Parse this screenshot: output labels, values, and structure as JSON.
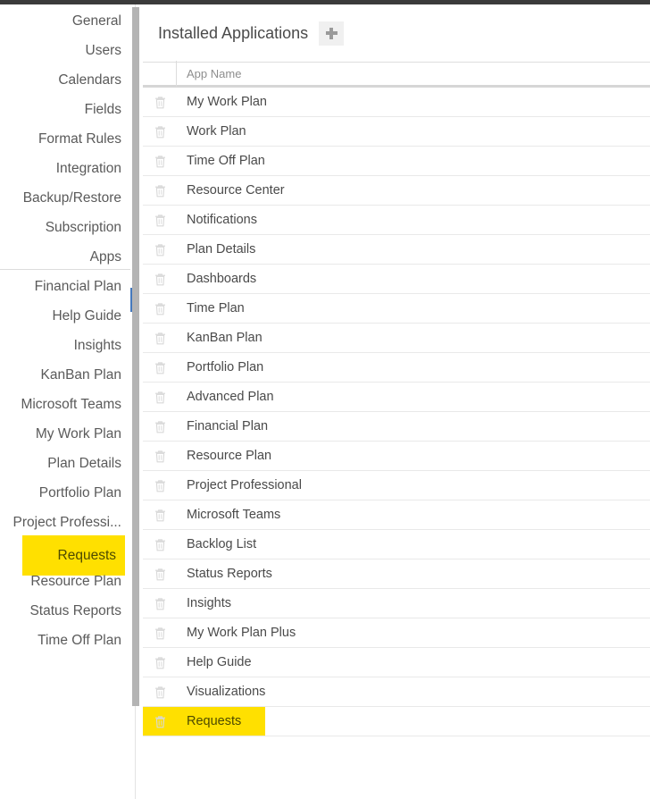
{
  "colors": {
    "accent_blue": "#4579bd",
    "highlight_yellow": "#ffe000",
    "top_strip": "#3b3b3b",
    "text_grey": "#4a4a4a",
    "sidebar_text": "#5a5a5a",
    "icon_grey": "#d8d8d8"
  },
  "sidebar": {
    "items": [
      {
        "label": "General",
        "active": false,
        "highlighted": false,
        "divider_after": false
      },
      {
        "label": "Users",
        "active": false,
        "highlighted": false,
        "divider_after": false
      },
      {
        "label": "Calendars",
        "active": false,
        "highlighted": false,
        "divider_after": false
      },
      {
        "label": "Fields",
        "active": false,
        "highlighted": false,
        "divider_after": false
      },
      {
        "label": "Format Rules",
        "active": false,
        "highlighted": false,
        "divider_after": false
      },
      {
        "label": "Integration",
        "active": false,
        "highlighted": false,
        "divider_after": false
      },
      {
        "label": "Backup/Restore",
        "active": false,
        "highlighted": false,
        "divider_after": false
      },
      {
        "label": "Subscription",
        "active": false,
        "highlighted": false,
        "divider_after": false
      },
      {
        "label": "Apps",
        "active": true,
        "highlighted": false,
        "divider_after": true
      },
      {
        "label": "Financial Plan",
        "active": false,
        "highlighted": false,
        "divider_after": false
      },
      {
        "label": "Help Guide",
        "active": false,
        "highlighted": false,
        "divider_after": false
      },
      {
        "label": "Insights",
        "active": false,
        "highlighted": false,
        "divider_after": false
      },
      {
        "label": "KanBan Plan",
        "active": false,
        "highlighted": false,
        "divider_after": false
      },
      {
        "label": "Microsoft Teams",
        "active": false,
        "highlighted": false,
        "divider_after": false
      },
      {
        "label": "My Work Plan",
        "active": false,
        "highlighted": false,
        "divider_after": false
      },
      {
        "label": "Plan Details",
        "active": false,
        "highlighted": false,
        "divider_after": false
      },
      {
        "label": "Portfolio Plan",
        "active": false,
        "highlighted": false,
        "divider_after": false
      },
      {
        "label": "Project Professi...",
        "active": false,
        "highlighted": false,
        "divider_after": false
      },
      {
        "label": "Requests",
        "active": false,
        "highlighted": true,
        "divider_after": false
      },
      {
        "label": "Resource Plan",
        "active": false,
        "highlighted": false,
        "divider_after": false
      },
      {
        "label": "Status Reports",
        "active": false,
        "highlighted": false,
        "divider_after": false
      },
      {
        "label": "Time Off Plan",
        "active": false,
        "highlighted": false,
        "divider_after": false
      }
    ]
  },
  "main": {
    "title": "Installed Applications",
    "add_button_icon": "plus-icon",
    "table": {
      "columns": [
        "",
        "App Name"
      ],
      "row_icon": "trash-icon",
      "rows": [
        {
          "name": "My Work Plan",
          "highlighted": false
        },
        {
          "name": "Work Plan",
          "highlighted": false
        },
        {
          "name": "Time Off Plan",
          "highlighted": false
        },
        {
          "name": "Resource Center",
          "highlighted": false
        },
        {
          "name": "Notifications",
          "highlighted": false
        },
        {
          "name": "Plan Details",
          "highlighted": false
        },
        {
          "name": "Dashboards",
          "highlighted": false
        },
        {
          "name": "Time Plan",
          "highlighted": false
        },
        {
          "name": "KanBan Plan",
          "highlighted": false
        },
        {
          "name": "Portfolio Plan",
          "highlighted": false
        },
        {
          "name": "Advanced Plan",
          "highlighted": false
        },
        {
          "name": "Financial Plan",
          "highlighted": false
        },
        {
          "name": "Resource Plan",
          "highlighted": false
        },
        {
          "name": "Project Professional",
          "highlighted": false
        },
        {
          "name": "Microsoft Teams",
          "highlighted": false
        },
        {
          "name": "Backlog List",
          "highlighted": false
        },
        {
          "name": "Status Reports",
          "highlighted": false
        },
        {
          "name": "Insights",
          "highlighted": false
        },
        {
          "name": "My Work Plan Plus",
          "highlighted": false
        },
        {
          "name": "Help Guide",
          "highlighted": false
        },
        {
          "name": "Visualizations",
          "highlighted": false
        },
        {
          "name": "Requests",
          "highlighted": true
        }
      ]
    }
  }
}
